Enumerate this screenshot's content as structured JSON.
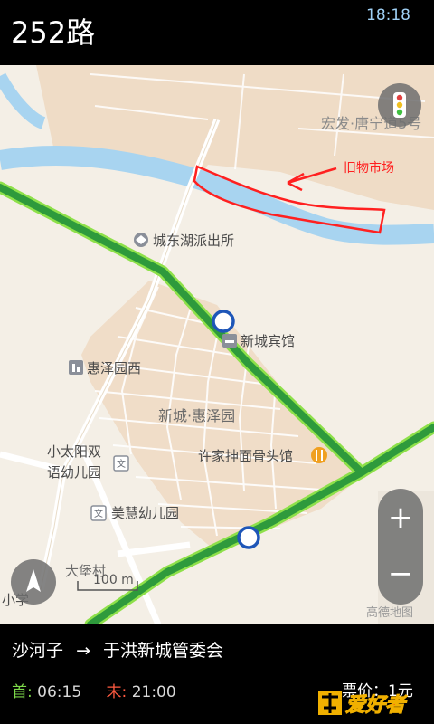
{
  "header": {
    "route_name": "252路",
    "time": "18:18"
  },
  "map": {
    "labels": {
      "district_top": "宏发·唐宁道5号",
      "annotation": "旧物市场",
      "police": "城东湖派出所",
      "hotel": "新城宾馆",
      "huize_west": "惠泽园西",
      "district_center": "新城·惠泽园",
      "noodle_shop": "许家抻面骨头馆",
      "kindergarten_1_line1": "小太阳双",
      "kindergarten_1_line2": "语幼儿园",
      "kindergarten_2": "美慧幼儿园",
      "village": "大堡村",
      "school_partial": "小学",
      "scale": "100 m",
      "attribution": "高德地图"
    },
    "controls": {
      "traffic": "traffic-light-icon",
      "compass": "compass-icon",
      "zoom_in": "+",
      "zoom_out": "−"
    },
    "colors": {
      "route": "#2e9a3c",
      "route_edge": "#8ee04a",
      "water": "#a8d4f0",
      "district": "#f0ddc8",
      "annotation": "#ff2020"
    }
  },
  "footer": {
    "from_stop": "沙河子",
    "arrow": "→",
    "to_stop": "于洪新城管委会",
    "first_label": "首:",
    "first_time": "06:15",
    "last_label": "末:",
    "last_time": "21:00",
    "fare_label": "票价：",
    "fare_value": "1元",
    "watermark": "爱好者"
  }
}
